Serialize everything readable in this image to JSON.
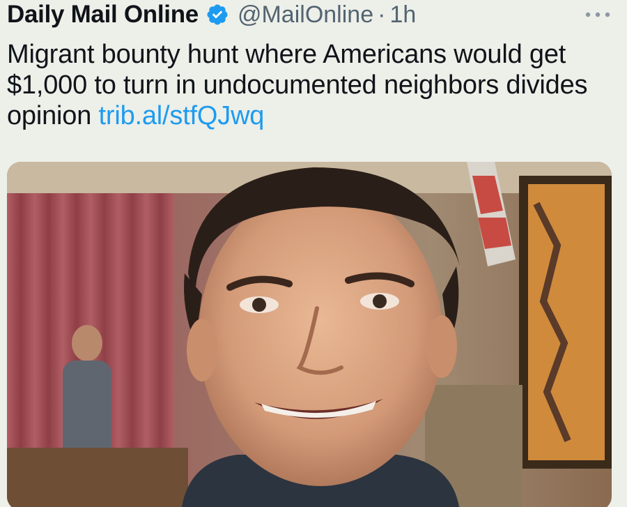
{
  "tweet": {
    "display_name": "Daily Mail Online",
    "verified_icon": "verified-badge-icon",
    "handle": "@MailOnline",
    "separator": "·",
    "time": "1h",
    "more_icon": "more-options-icon",
    "text": "Migrant bounty hunt where Americans would get $1,000 to turn in undocumented neighbors divides opinion",
    "link_text": "trib.al/stfQJwq",
    "media_description_icon": "photo-thumbnail"
  },
  "colors": {
    "background": "#edefe9",
    "text": "#0f1419",
    "secondary_text": "#536471",
    "link": "#1d9bf0",
    "verified": "#1d9bf0"
  }
}
